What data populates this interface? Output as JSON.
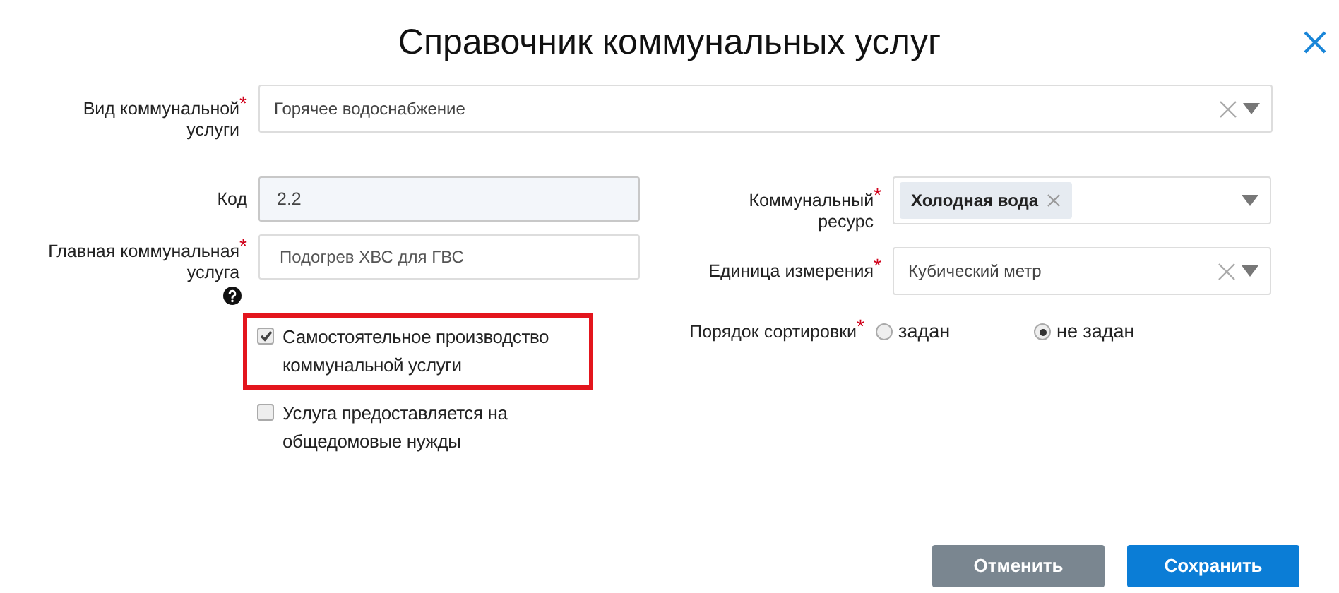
{
  "dialog": {
    "title": "Справочник коммунальных услуг"
  },
  "service_type": {
    "label": "Вид коммунальной услуги",
    "required_mark": "*",
    "value": "Горячее водоснабжение",
    "clearable": true
  },
  "code": {
    "label": "Код",
    "value": "2.2",
    "disabled": true
  },
  "main_service": {
    "label": "Главная коммунальная услуга",
    "required_mark": "*",
    "value": "Подогрев ХВС для ГВС",
    "help": true
  },
  "checkboxes": [
    {
      "label": "Самостоятельное производство коммунальной услуги",
      "checked": true,
      "highlighted": true
    },
    {
      "label": "Услуга предоставляется на общедомовые нужды",
      "checked": false,
      "highlighted": false
    }
  ],
  "resource": {
    "label": "Коммунальный ресурс",
    "required_mark": "*",
    "tags": [
      "Холодная вода"
    ]
  },
  "unit": {
    "label": "Единица измерения",
    "required_mark": "*",
    "value": "Кубический метр",
    "clearable": true
  },
  "sort_order": {
    "label": "Порядок сортировки",
    "required_mark": "*",
    "options": [
      {
        "label": "задан",
        "selected": false
      },
      {
        "label": "не задан",
        "selected": true
      }
    ]
  },
  "buttons": [
    {
      "label": "Отменить",
      "kind": "secondary"
    },
    {
      "label": "Сохранить",
      "kind": "primary"
    }
  ]
}
